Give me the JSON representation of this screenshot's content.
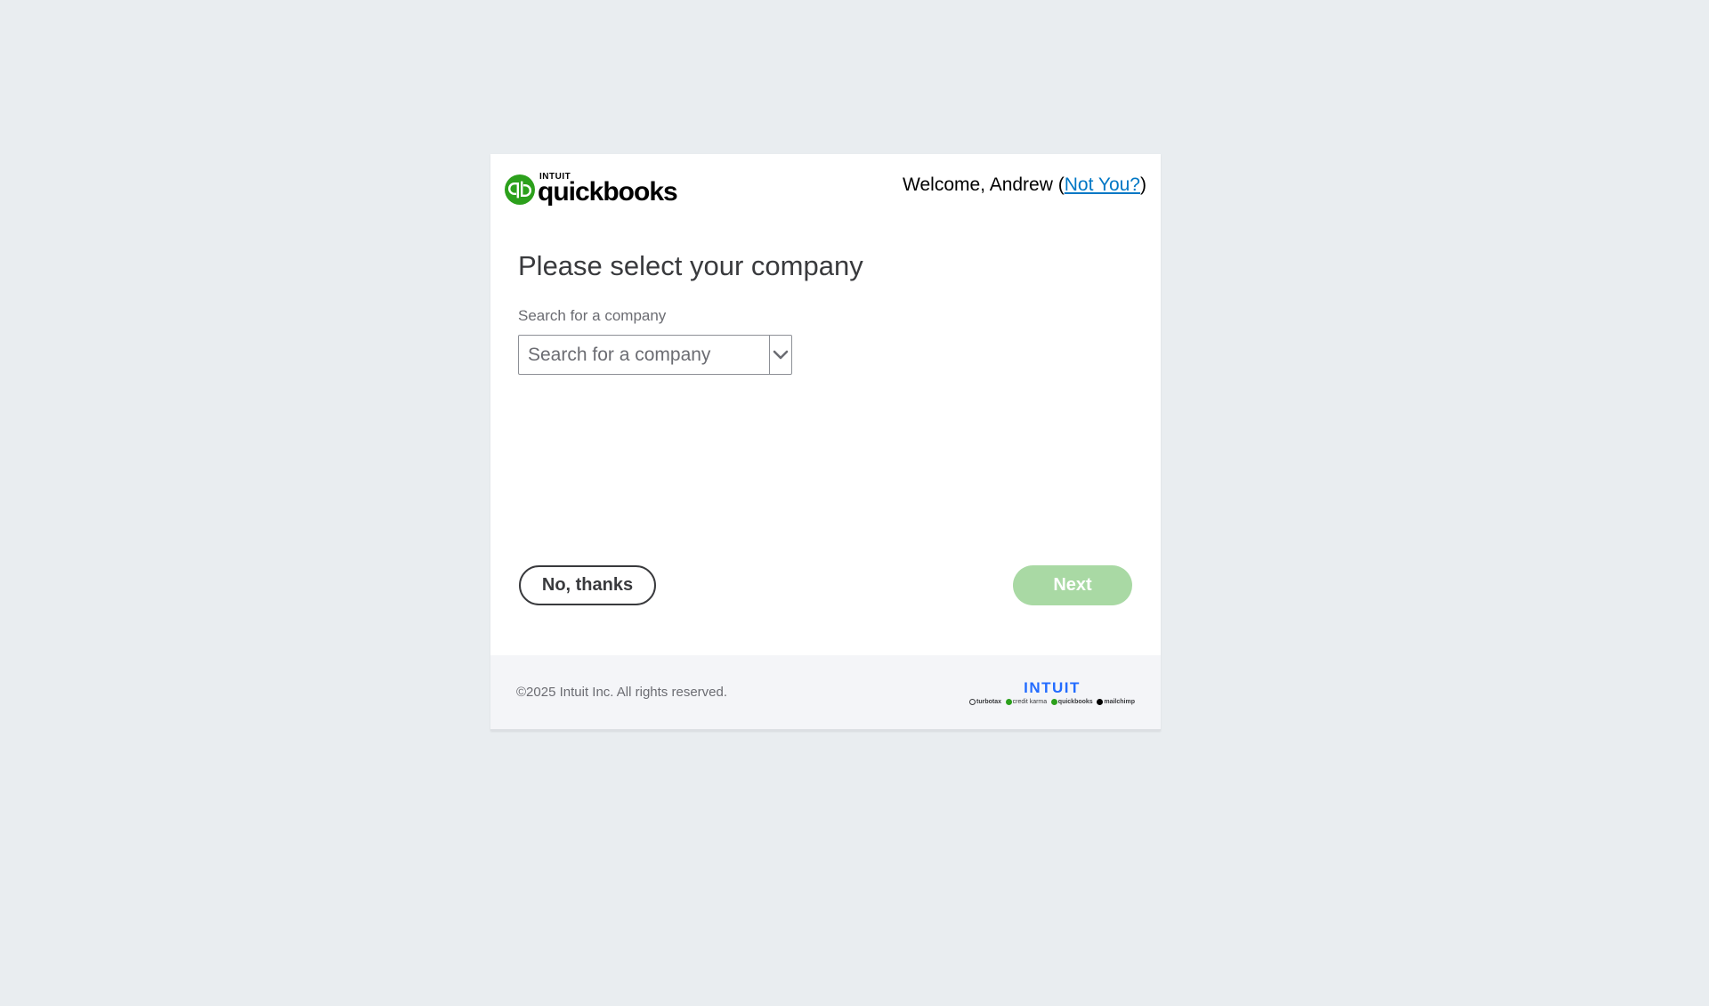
{
  "header": {
    "logo_intuit": "INTUIT",
    "logo_name": "quickbooks",
    "welcome_prefix": "Welcome, Andrew (",
    "not_you_link": "Not You?",
    "welcome_suffix": ")"
  },
  "main": {
    "title": "Please select your company",
    "search_label": "Search for a company",
    "search_placeholder": "Search for a company",
    "search_value": ""
  },
  "actions": {
    "no_thanks_label": "No, thanks",
    "next_label": "Next"
  },
  "footer": {
    "copyright": "©2025 Intuit Inc. All rights reserved.",
    "intuit_logo": "INTUIT",
    "brands": [
      {
        "name": "turbotax",
        "color": "#393a3d"
      },
      {
        "name": "credit karma",
        "color": "#2ca01c"
      },
      {
        "name": "quickbooks",
        "color": "#2ca01c"
      },
      {
        "name": "mailchimp",
        "color": "#000000"
      }
    ]
  },
  "colors": {
    "page_bg": "#e9edf0",
    "brand_green": "#2ca01c",
    "next_disabled": "#a9d9a4",
    "link_blue": "#0077c5",
    "intuit_blue": "#236cff"
  },
  "icons": {
    "logo": "quickbooks-logo-icon",
    "dropdown": "chevron-down-icon"
  }
}
